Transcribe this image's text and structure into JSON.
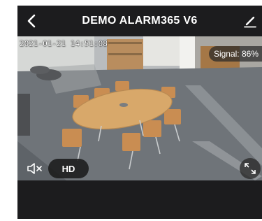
{
  "header": {
    "title": "DEMO ALARM365 V6",
    "back_icon": "chevron-left-icon",
    "edit_icon": "pencil-icon"
  },
  "video": {
    "timestamp": "2021-01-21 14:51:08",
    "signal_label": "Signal: 86%",
    "hd_label": "HD",
    "mute_icon": "speaker-muted-icon",
    "fullscreen_icon": "fullscreen-icon"
  },
  "colors": {
    "background": "#1c1c1e",
    "text": "#ffffff",
    "table": "#d8a86a",
    "chair": "#c98d52"
  }
}
